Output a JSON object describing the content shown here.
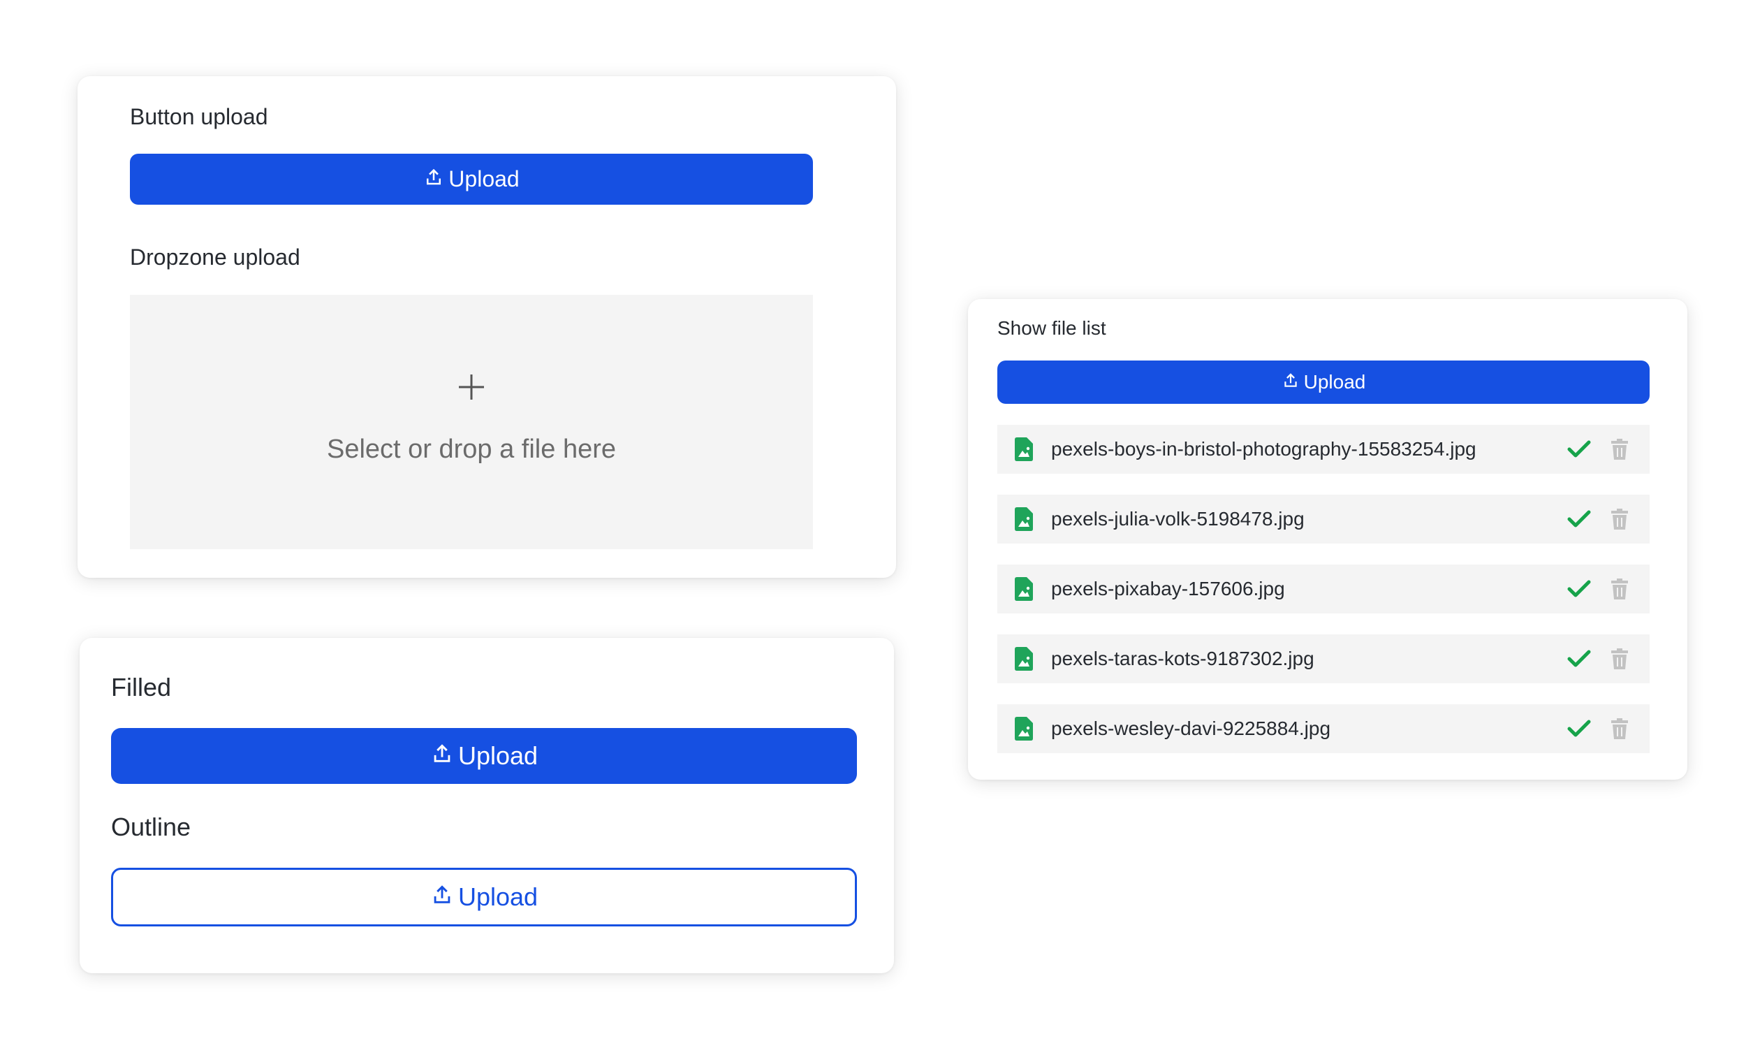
{
  "button_upload_card": {
    "title": "Button upload",
    "button_label": "Upload",
    "dropzone_title": "Dropzone upload",
    "dropzone_icon": "plus-icon",
    "dropzone_text": "Select or drop a file here"
  },
  "variants_card": {
    "filled_title": "Filled",
    "filled_button_label": "Upload",
    "outline_title": "Outline",
    "outline_button_label": "Upload"
  },
  "file_list_card": {
    "title": "Show file list",
    "button_label": "Upload",
    "files": [
      {
        "name": "pexels-boys-in-bristol-photography-15583254.jpg",
        "status": "uploaded"
      },
      {
        "name": "pexels-julia-volk-5198478.jpg",
        "status": "uploaded"
      },
      {
        "name": "pexels-pixabay-157606.jpg",
        "status": "uploaded"
      },
      {
        "name": "pexels-taras-kots-9187302.jpg",
        "status": "uploaded"
      },
      {
        "name": "pexels-wesley-davi-9225884.jpg",
        "status": "uploaded"
      }
    ]
  },
  "icons": {
    "upload": "upload-icon",
    "file": "image-file-icon",
    "success": "check-icon",
    "delete": "trash-icon"
  },
  "colors": {
    "primary": "#1650e2",
    "success": "#16a34a",
    "file_icon": "#1fa45a",
    "muted_icon": "#c2c2c2",
    "dropzone_bg": "#f4f4f4",
    "row_bg": "#f4f4f4"
  }
}
